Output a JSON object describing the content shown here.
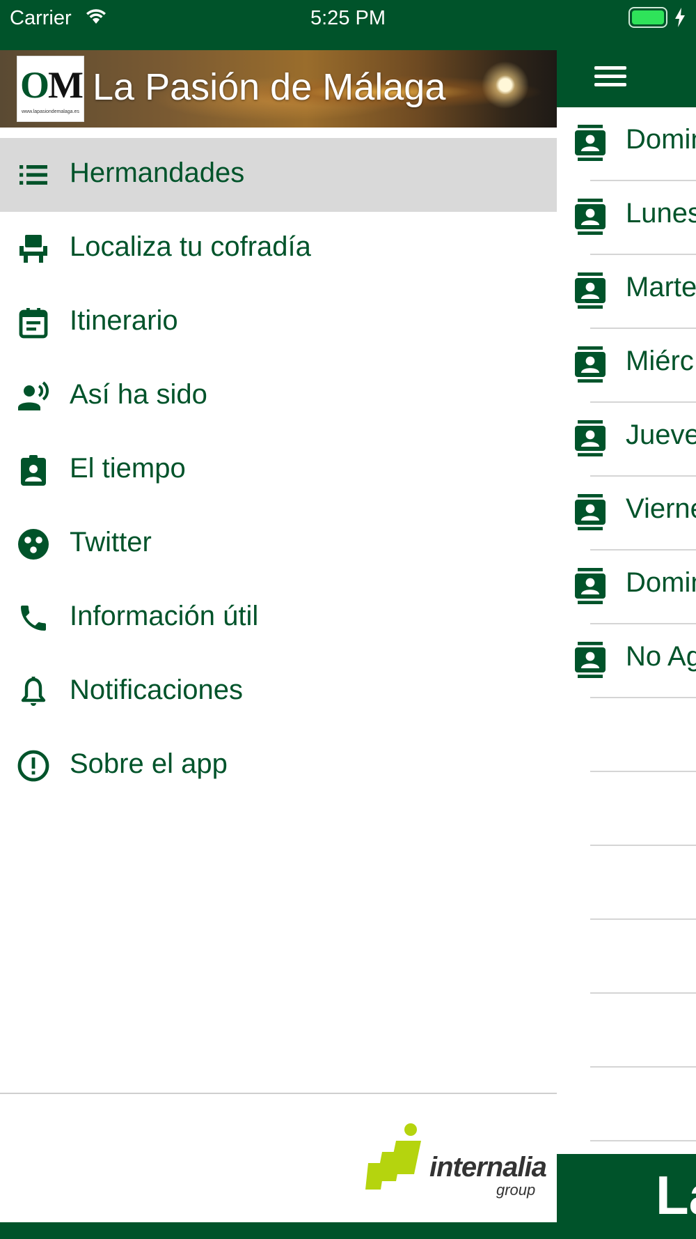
{
  "status_bar": {
    "carrier": "Carrier",
    "time": "5:25 PM",
    "icons": [
      "wifi-icon",
      "battery-icon",
      "charging-bolt-icon"
    ]
  },
  "colors": {
    "brand_green": "#00532a",
    "selected_bg": "#d9d9d9",
    "divider": "#d5d5d5",
    "battery": "#2fe35a",
    "logo_accent": "#b5d40e"
  },
  "drawer": {
    "header": {
      "title": "La Pasión de Málaga",
      "logo_text_o": "O",
      "logo_text_m": "M",
      "logo_url": "www.lapasiondemalaga.es"
    },
    "menu": [
      {
        "label": "Hermandades",
        "icon": "list-icon",
        "selected": true
      },
      {
        "label": "Localiza tu cofradía",
        "icon": "seat-icon",
        "selected": false
      },
      {
        "label": "Itinerario",
        "icon": "calendar-icon",
        "selected": false
      },
      {
        "label": "Así ha sido",
        "icon": "speaker-person-icon",
        "selected": false
      },
      {
        "label": "El tiempo",
        "icon": "clipboard-person-icon",
        "selected": false
      },
      {
        "label": "Twitter",
        "icon": "dots-circle-icon",
        "selected": false
      },
      {
        "label": "Información útil",
        "icon": "phone-icon",
        "selected": false
      },
      {
        "label": "Notificaciones",
        "icon": "bell-icon",
        "selected": false
      },
      {
        "label": "Sobre el app",
        "icon": "alert-circle-icon",
        "selected": false
      }
    ],
    "footer": {
      "brand_name": "internalia",
      "brand_sub": "group"
    }
  },
  "main": {
    "menu_icon": "hamburger-icon",
    "list": [
      {
        "label": "Domin",
        "icon": "contact-card-icon"
      },
      {
        "label": "Lunes",
        "icon": "contact-card-icon"
      },
      {
        "label": "Marte",
        "icon": "contact-card-icon"
      },
      {
        "label": "Miérc",
        "icon": "contact-card-icon"
      },
      {
        "label": "Jueve",
        "icon": "contact-card-icon"
      },
      {
        "label": "Vierne",
        "icon": "contact-card-icon"
      },
      {
        "label": "Domin",
        "icon": "contact-card-icon"
      },
      {
        "label": "No Ag",
        "icon": "contact-card-icon"
      }
    ],
    "bottom_banner_text": "La"
  }
}
